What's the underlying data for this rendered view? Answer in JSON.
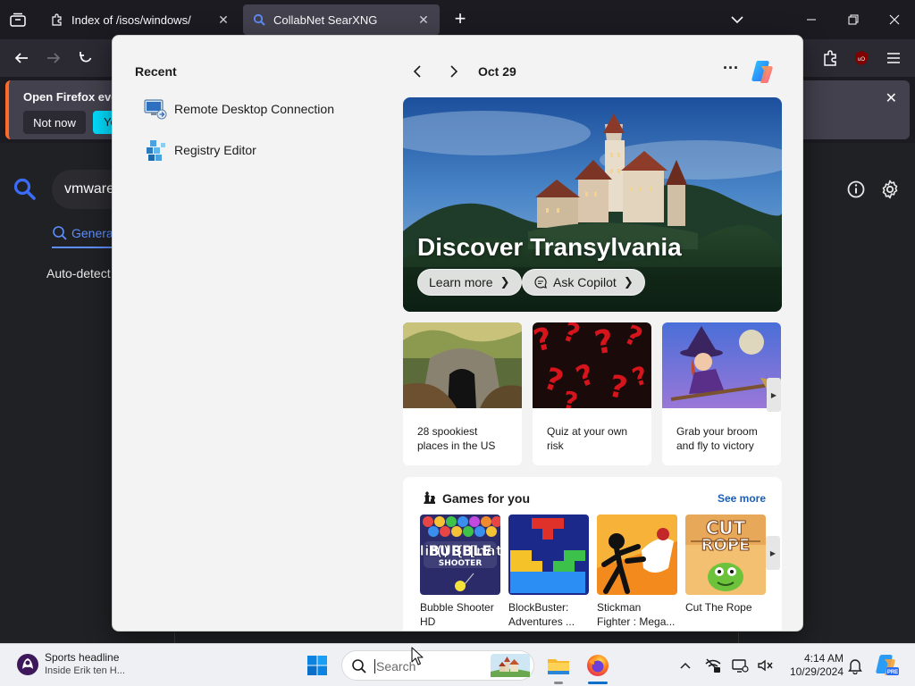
{
  "browser": {
    "tabs": [
      {
        "title": "Index of /isos/windows/"
      },
      {
        "title": "CollabNet SearXNG"
      }
    ],
    "new_tab": "+",
    "notification": {
      "message": "Open Firefox ever",
      "not_now": "Not now",
      "yes": "Ye"
    }
  },
  "page": {
    "query": "vmware",
    "tab_general": "Genera",
    "autodetect": "Auto-detect"
  },
  "start_menu": {
    "recent_title": "Recent",
    "recent_items": [
      {
        "label": "Remote Desktop Connection"
      },
      {
        "label": "Registry Editor"
      }
    ],
    "date": "Oct 29",
    "more": "···",
    "hero": {
      "title": "Discover Transylvania",
      "learn_more": "Learn more",
      "ask_copilot": "Ask Copilot"
    },
    "cards": [
      {
        "caption": "28 spookiest places in the US"
      },
      {
        "caption": "Quiz at your own risk"
      },
      {
        "caption": "Grab your broom and fly to victory"
      }
    ],
    "games": {
      "title": "Games for you",
      "see_more": "See more",
      "items": [
        {
          "name": "Bubble Shooter HD",
          "art": "BUBBLE SHOOTER"
        },
        {
          "name": "BlockBuster: Adventures ...",
          "art": ""
        },
        {
          "name": "Stickman Fighter : Mega...",
          "art": ""
        },
        {
          "name": "Cut The Rope",
          "art": "CUT the ROPE"
        }
      ]
    }
  },
  "taskbar": {
    "sports_headline": "Sports headline",
    "sports_sub": "Inside Erik ten H...",
    "search_placeholder": "Search",
    "time": "4:14 AM",
    "date": "10/29/2024"
  },
  "colors": {
    "accent_blue": "#5e8efc",
    "firefox_cyan": "#00ddff",
    "link_blue": "#1a5fb4"
  }
}
